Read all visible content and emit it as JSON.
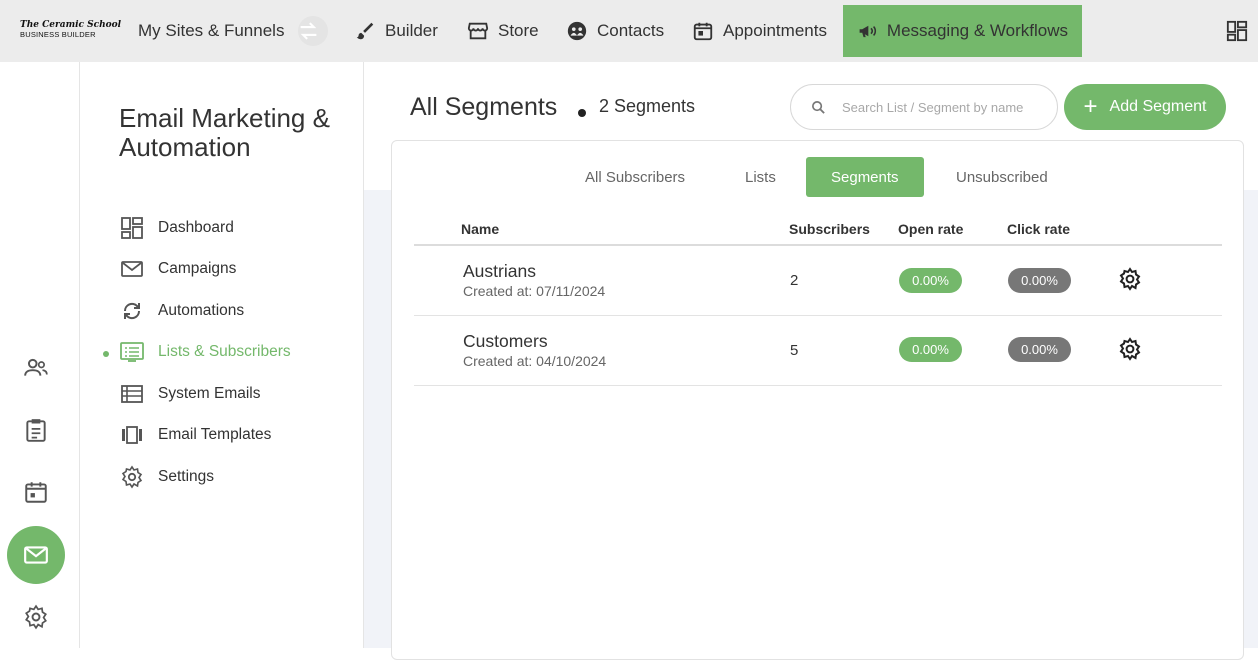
{
  "logo": {
    "line1": "The Ceramic School",
    "line2": "BUSINESS BUILDER"
  },
  "topnav": {
    "sites": "My Sites & Funnels",
    "builder": "Builder",
    "store": "Store",
    "contacts": "Contacts",
    "appointments": "Appointments",
    "messaging": "Messaging & Workflows"
  },
  "sidemenu": {
    "title": "Email Marketing & Automation",
    "items": [
      {
        "label": "Dashboard",
        "icon": "dashboard-icon"
      },
      {
        "label": "Campaigns",
        "icon": "envelope-icon"
      },
      {
        "label": "Automations",
        "icon": "sync-icon"
      },
      {
        "label": "Lists & Subscribers",
        "icon": "list-icon"
      },
      {
        "label": "System Emails",
        "icon": "list-lines-icon"
      },
      {
        "label": "Email Templates",
        "icon": "carousel-icon"
      },
      {
        "label": "Settings",
        "icon": "gear-icon"
      }
    ],
    "active_index": 3
  },
  "main": {
    "title": "All Segments",
    "count": "2 Segments",
    "search_placeholder": "Search List / Segment by name",
    "add_button": "Add Segment",
    "tabs": [
      "All Subscribers",
      "Lists",
      "Segments",
      "Unsubscribed"
    ],
    "active_tab": "Segments",
    "table": {
      "headers": [
        "Name",
        "Subscribers",
        "Open rate",
        "Click rate"
      ],
      "rows": [
        {
          "name": "Austrians",
          "created": "Created at: 07/11/2024",
          "subscribers": "2",
          "open_rate": "0.00%",
          "click_rate": "0.00%"
        },
        {
          "name": "Customers",
          "created": "Created at: 04/10/2024",
          "subscribers": "5",
          "open_rate": "0.00%",
          "click_rate": "0.00%"
        }
      ]
    }
  },
  "colors": {
    "accent": "#74b86b",
    "gray_pill": "#777777",
    "topbar": "#ececec"
  }
}
